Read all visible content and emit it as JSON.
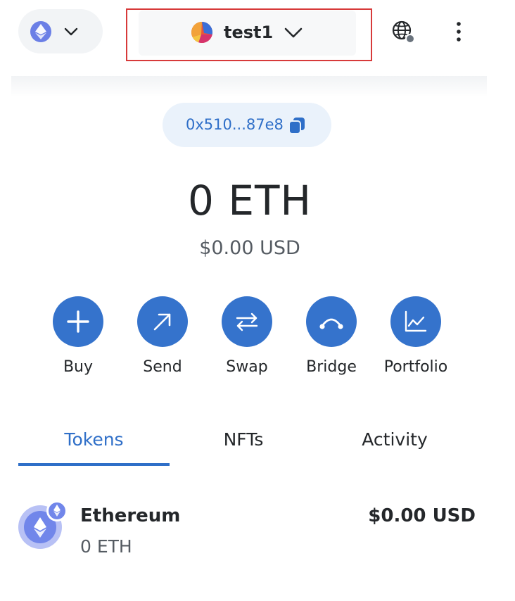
{
  "header": {
    "network": {
      "icon": "ethereum-icon",
      "dropdown_icon": "chevron-down-icon"
    },
    "account": {
      "name": "test1",
      "icon": "account-avatar",
      "dropdown_icon": "chevron-down-icon"
    },
    "connection_icon": "globe-icon",
    "menu_icon": "kebab-menu-icon"
  },
  "address": {
    "short": "0x510...87e8",
    "icon": "copy-icon"
  },
  "balance": {
    "amount": "0 ETH",
    "fiat": "$0.00 USD"
  },
  "actions": [
    {
      "label": "Buy",
      "icon": "plus-icon"
    },
    {
      "label": "Send",
      "icon": "arrow-up-right-icon"
    },
    {
      "label": "Swap",
      "icon": "swap-arrows-icon"
    },
    {
      "label": "Bridge",
      "icon": "bridge-icon"
    },
    {
      "label": "Portfolio",
      "icon": "chart-icon"
    }
  ],
  "tabs": [
    {
      "label": "Tokens",
      "active": true
    },
    {
      "label": "NFTs",
      "active": false
    },
    {
      "label": "Activity",
      "active": false
    }
  ],
  "tokens": [
    {
      "name": "Ethereum",
      "amount": "0 ETH",
      "fiat": "$0.00 USD",
      "icon": "ethereum-icon"
    }
  ],
  "colors": {
    "accent": "#3573cc",
    "link": "#2f6fc8",
    "highlight": "#d73a3a",
    "eth": "#6b7fe6"
  }
}
